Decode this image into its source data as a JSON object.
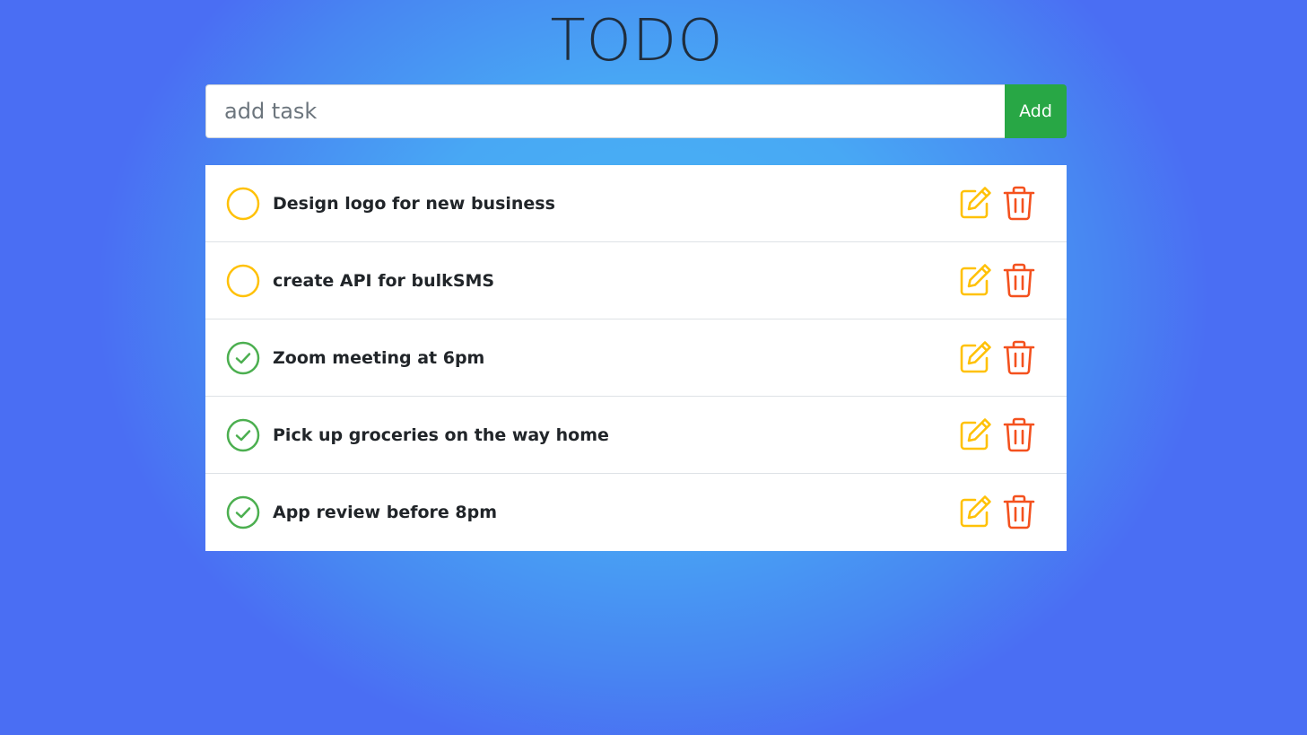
{
  "header": {
    "title": "TODO"
  },
  "form": {
    "input_value": "",
    "input_placeholder": "add task",
    "add_label": "Add"
  },
  "tasks": [
    {
      "label": "Design logo for new business",
      "done": false
    },
    {
      "label": "create API for bulkSMS",
      "done": false
    },
    {
      "label": "Zoom meeting at 6pm",
      "done": true
    },
    {
      "label": "Pick up groceries on the way home",
      "done": true
    },
    {
      "label": "App review before 8pm",
      "done": true
    }
  ],
  "icons": {
    "pending": "circle-icon",
    "done": "check-circle-icon",
    "edit": "pencil-square-icon",
    "delete": "trash-icon"
  },
  "colors": {
    "add_button": "#28a745",
    "pending": "#ffc107",
    "done": "#4caf50",
    "edit": "#ffc107",
    "delete": "#f4511e"
  }
}
